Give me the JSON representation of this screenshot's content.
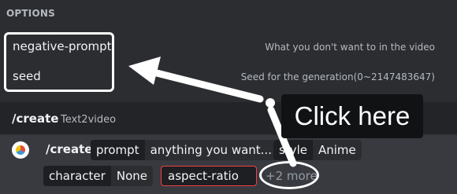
{
  "options": {
    "header": "OPTIONS",
    "items": [
      {
        "name": "negative-prompt",
        "description": "What you don't want to in the video"
      },
      {
        "name": "seed",
        "description": "Seed for the generation(0~2147483647)"
      }
    ]
  },
  "command": {
    "name": "/create",
    "description": "Text2video"
  },
  "input": {
    "command": "/create",
    "avatar_icon": "bot-avatar-icon",
    "params": [
      {
        "key": "prompt",
        "value": "anything you want..."
      },
      {
        "key": "style",
        "value": "Anime"
      },
      {
        "key": "character",
        "value": "None"
      }
    ],
    "active_param": "aspect-ratio",
    "more": "+2 more"
  },
  "annotation": {
    "tooltip": "Click here",
    "color": "#ffffff"
  }
}
